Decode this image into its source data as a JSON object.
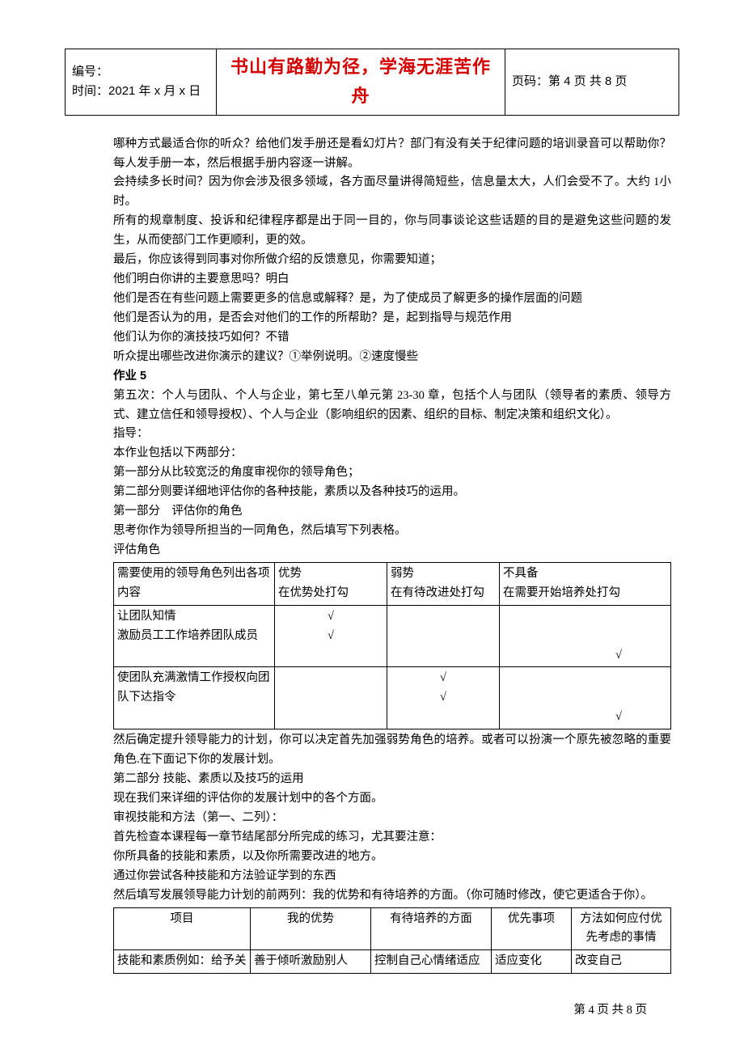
{
  "header": {
    "bianhao_label": "编号：",
    "shijian_label": "时间：",
    "shijian_value": "2021 年 x 月 x 日",
    "center": "书山有路勤为径，学海无涯苦作舟",
    "yema_label": "页码：",
    "yema_value": "第 4 页  共 8 页"
  },
  "body": {
    "p1": "哪种方式最适合你的听众？给他们发手册还是看幻灯片？部门有没有关于纪律问题的培训录音可以帮助你？每人发手册一本，然后根据手册内容逐一讲解。",
    "p2": "会持续多长时间？因为你会涉及很多领域，各方面尽量讲得简短些，信息量太大，人们会受不了。大约 1小时。",
    "p3": "所有的规章制度、投诉和纪律程序都是出于同一目的，你与同事谈论这些话题的目的是避免这些问题的发生，从而使部门工作更顺利，更的效。",
    "p4": "最后，你应该得到同事对你所做介绍的反馈意见，你需要知道；",
    "p5": "他们明白你讲的主要意思吗？明白",
    "p6": "他们是否在有些问题上需要更多的信息或解释？是，为了使成员了解更多的操作层面的问题",
    "p7": "他们是否认为的用，是否会对他们的工作的所帮助？是，起到指导与规范作用",
    "p8": "他们认为你的演技技巧如何？不错",
    "p9": "听众提出哪些改进你演示的建议？①举例说明。②速度慢些",
    "h_zy5": "作业 5",
    "p10": "第五次：个人与团队、个人与企业，第七至八单元第 23-30 章，包括个人与团队（领导者的素质、领导方式、建立信任和领导授权）、个人与企业（影响组织的因素、组织的目标、制定决策和组织文化）。",
    "p11": "指导：",
    "p12": "本作业包括以下两部分：",
    "p13": "第一部分从比较宽泛的角度审视你的领导角色；",
    "p14": "第二部分则要详细地评估你的各种技能，素质以及各种技巧的运用。",
    "p15": "第一部分　评估你的角色",
    "p16": "思考你作为领导所担当的一同角色，然后填写下列表格。",
    "p17": "评估角色",
    "p18": "然后确定提升领导能力的计划，你可以决定首先加强弱势角色的培养。或者可以扮演一个原先被忽略的重要角色.在下面记下你的发展计划。",
    "p19": "第二部分  技能、素质以及技巧的运用",
    "p20": "现在我们来详细的评估你的发展计划中的各个方面。",
    "p21": "审视技能和方法（第一、二列）：",
    "p22": "首先检查本课程每一章节结尾部分所完成的练习，尤其要注意：",
    "p23": "你所具备的技能和素质，以及你所需要改进的地方。",
    "p24": "通过你尝试各种技能和方法验证学到的东西",
    "p25": "然后填写发展领导能力计划的前两列：我的优势和有待培养的方面。（你可随时修改，使它更适合于你）。"
  },
  "table1": {
    "h1a": "需要使用的领导角色列出各项内容",
    "h2a": "优势",
    "h2b": "在优势处打勾",
    "h3a": "弱势",
    "h3b": "在有待改进处打勾",
    "h4a": "不具备",
    "h4b": "在需要开始培养处打勾",
    "r1c1": "让团队知情",
    "r1c2": "√",
    "r2c1": "激励员工工作培养团队成员",
    "r2c2": "√",
    "r2c4": "√",
    "r3c1": "使团队充满激情工作授权向团队下达指令",
    "r3c3a": "√",
    "r3c3b": "√",
    "r3c4": "√"
  },
  "table2": {
    "h1": "项目",
    "h2": "我的优势",
    "h3": "有待培养的方面",
    "h4": "优先事项",
    "h5": "方法如何应付优先考虑的事情",
    "r1c1": "技能和素质例如：给予关",
    "r1c2": "善于倾听激励别人",
    "r1c3": "控制自己心情绪适应",
    "r1c4": "适应变化",
    "r1c5": "改变自己"
  },
  "footer": {
    "text": "第 4 页 共 8 页"
  }
}
